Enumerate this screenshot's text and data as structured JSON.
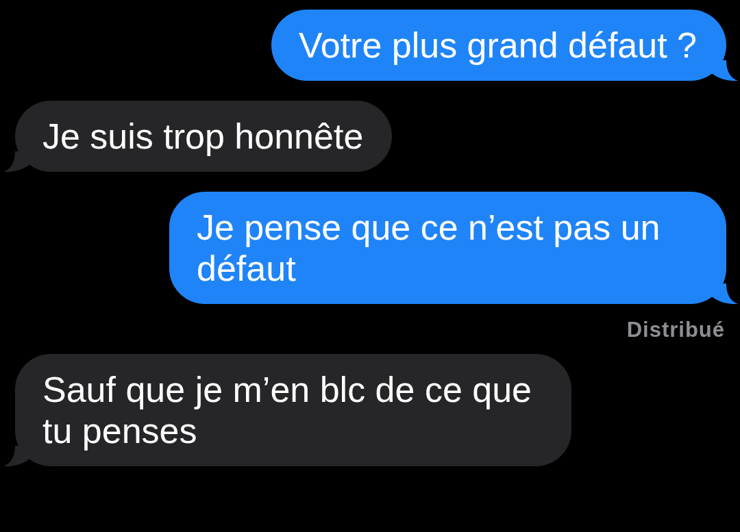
{
  "messages": [
    {
      "kind": "sent",
      "text": "Votre plus grand défaut ?"
    },
    {
      "kind": "received",
      "text": "Je suis trop honnête"
    },
    {
      "kind": "sent",
      "text": "Je pense que ce n’est pas un défaut",
      "status": "Distribué"
    },
    {
      "kind": "received",
      "text": "Sauf que je m’en blc de ce que tu penses"
    }
  ]
}
